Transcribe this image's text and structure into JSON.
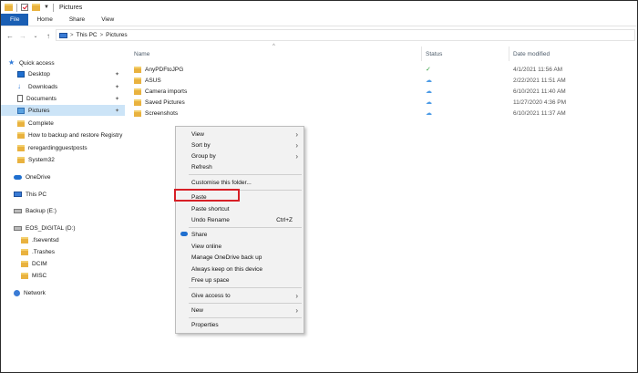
{
  "window": {
    "title": "Pictures"
  },
  "ribbon": {
    "tabs": [
      "File",
      "Home",
      "Share",
      "View"
    ]
  },
  "address": {
    "crumbs": [
      "This PC",
      "Pictures"
    ]
  },
  "sidebar": {
    "items": [
      {
        "label": "Quick access"
      },
      {
        "label": "Desktop"
      },
      {
        "label": "Downloads"
      },
      {
        "label": "Documents"
      },
      {
        "label": "Pictures"
      },
      {
        "label": "Complete"
      },
      {
        "label": "How to backup and restore Registry"
      },
      {
        "label": "reregardingguestposts"
      },
      {
        "label": "System32"
      },
      {
        "label": "OneDrive"
      },
      {
        "label": "This PC"
      },
      {
        "label": "Backup  (E:)"
      },
      {
        "label": "EOS_DIGITAL (D:)"
      },
      {
        "label": ".fseventsd"
      },
      {
        "label": ".Trashes"
      },
      {
        "label": "DCIM"
      },
      {
        "label": "MISC"
      },
      {
        "label": "Network"
      }
    ]
  },
  "columns": {
    "name": "Name",
    "status": "Status",
    "date": "Date modified"
  },
  "files": [
    {
      "name": "AnyPDFtoJPG",
      "status": "synced",
      "date": "4/1/2021 11:56 AM"
    },
    {
      "name": "ASUS",
      "status": "cloud",
      "date": "2/22/2021 11:51 AM"
    },
    {
      "name": "Camera imports",
      "status": "cloud",
      "date": "6/10/2021 11:40 AM"
    },
    {
      "name": "Saved Pictures",
      "status": "cloud",
      "date": "11/27/2020 4:36 PM"
    },
    {
      "name": "Screenshots",
      "status": "cloud",
      "date": "6/10/2021 11:37 AM"
    }
  ],
  "context_menu": {
    "view": "View",
    "sort_by": "Sort by",
    "group_by": "Group by",
    "refresh": "Refresh",
    "customise": "Customise this folder...",
    "paste": "Paste",
    "paste_shortcut": "Paste shortcut",
    "undo_rename": "Undo Rename",
    "undo_shortcut": "Ctrl+Z",
    "share": "Share",
    "view_online": "View online",
    "manage_backup": "Manage OneDrive back up",
    "always_keep": "Always keep on this device",
    "free_up": "Free up space",
    "give_access": "Give access to",
    "new": "New",
    "properties": "Properties"
  },
  "colors": {
    "accent": "#1a5fb4",
    "selection": "#cce4f7",
    "highlight_box": "#d71f26"
  }
}
